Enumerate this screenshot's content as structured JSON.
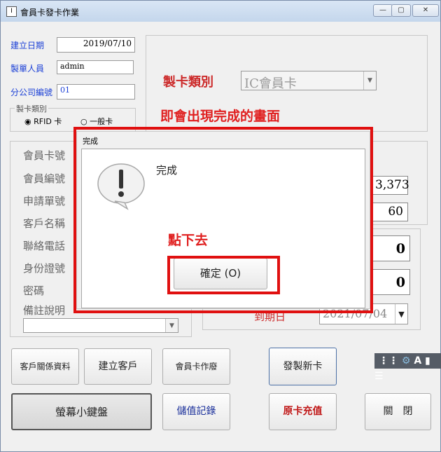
{
  "window": {
    "title": "會員卡發卡作業",
    "icon_glyph": "I"
  },
  "form": {
    "date_label": "建立日期",
    "date_value": "2019/07/10",
    "maker_label": "製單人員",
    "maker_value": "admin",
    "branch_label": "分公司編號",
    "branch_value": "01",
    "card_type_group": "製卡類別",
    "radio_rfid": "RFID 卡",
    "radio_normal": "一般卡"
  },
  "card_type": {
    "label": "製卡類別",
    "value": "IC會員卡"
  },
  "annotation_top": "即會出現完成的畫面",
  "annotation_click": "點下去",
  "left_labels": [
    "會員卡號",
    "會員編號",
    "申請單號",
    "客戶名稱",
    "聯絡電話",
    "身份證號",
    "密碼",
    "備註說明"
  ],
  "right_values": {
    "v1": "3,373",
    "v2": "60",
    "box1": "0",
    "box2": "0"
  },
  "expiry": {
    "label": "到期日",
    "value": "2021/07/04"
  },
  "dialog": {
    "title": "完成",
    "message": "完成",
    "ok_text": "確定 (O)"
  },
  "buttons": {
    "customer_info": "客戶關係資料",
    "create_customer": "建立客戶",
    "card_void": "會員卡作廢",
    "issue_card": "發製新卡",
    "keyboard": "螢幕小鍵盤",
    "stored_value": "儲值記錄",
    "recharge": "原卡充值",
    "close": "關　閉"
  },
  "ime_bar": "A"
}
